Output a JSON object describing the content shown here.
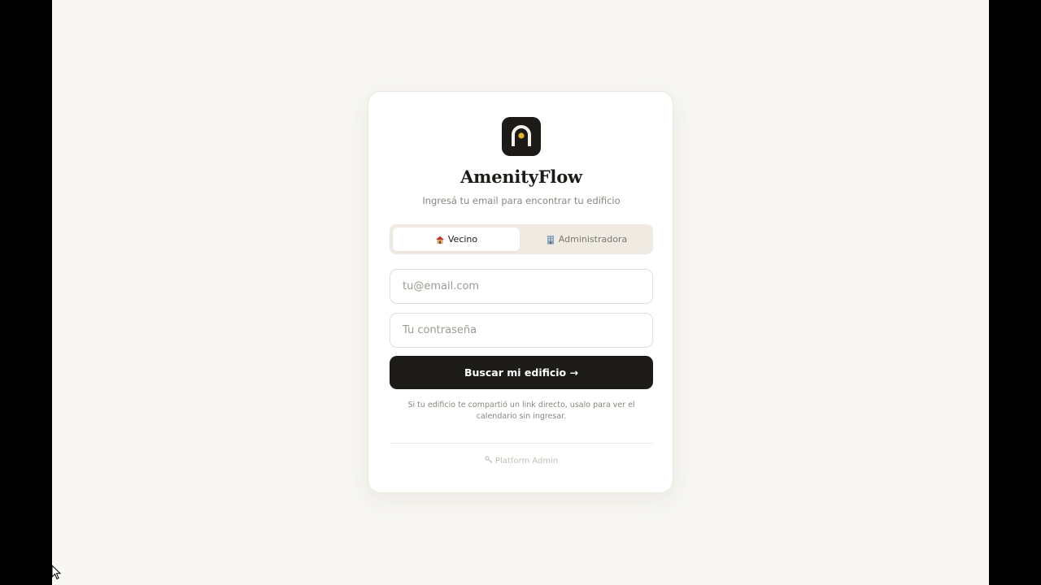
{
  "app": {
    "name": "AmenityFlow",
    "subtitle": "Ingresá tu email para encontrar tu edificio"
  },
  "tabs": [
    {
      "label": "Vecino",
      "icon": "house-icon",
      "active": true
    },
    {
      "label": "Administradora",
      "icon": "office-building-icon",
      "active": false
    }
  ],
  "form": {
    "email_placeholder": "tu@email.com",
    "email_value": "",
    "password_placeholder": "Tu contraseña",
    "password_value": "",
    "submit_label": "Buscar mi edificio →"
  },
  "note": "Si tu edificio te compartió un link directo, usalo para ver el calendario sin ingresar.",
  "footer": {
    "admin_link_label": "Platform Admin",
    "admin_link_icon": "key-icon"
  },
  "colors": {
    "background": "#f8f7f3",
    "primary": "#1d1b17",
    "accent": "#e0b22c"
  }
}
